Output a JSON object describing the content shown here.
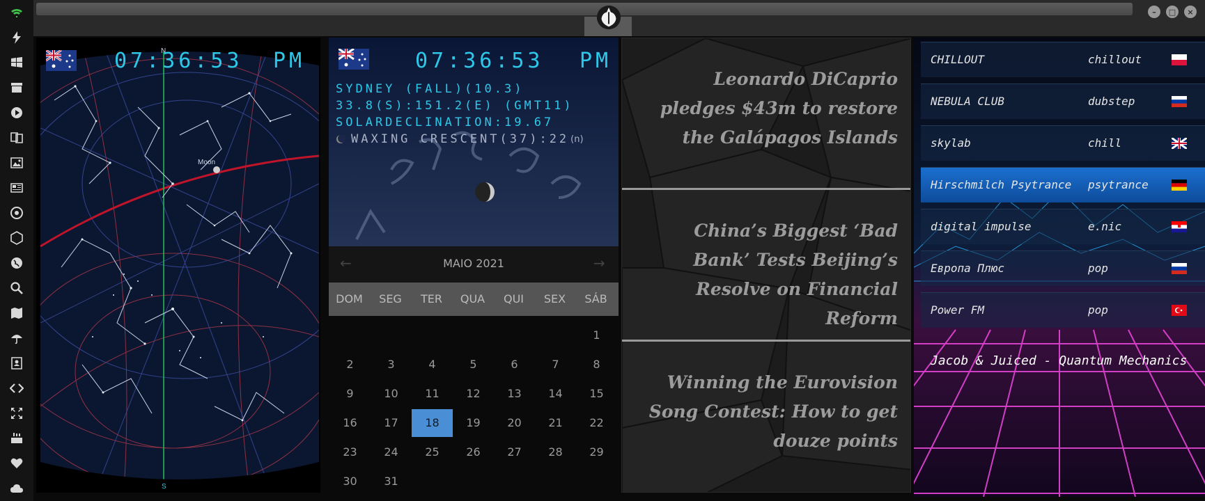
{
  "sidebar": {
    "icons": [
      "wifi-icon",
      "lightning-icon",
      "windows-icon",
      "archive-icon",
      "play-icon",
      "translate-icon",
      "image-icon",
      "newspaper-icon",
      "empire-icon",
      "hexagon-icon",
      "globe-icon",
      "search-icon",
      "map-icon",
      "umbrella-icon",
      "contact-icon",
      "code-icon",
      "expand-icon",
      "youtube-icon",
      "heart-icon",
      "cloud-icon"
    ]
  },
  "colors": {
    "accent": "#2fc7e8",
    "selected_day": "#4a8fd6",
    "active_station": "#1a6fd0"
  },
  "starmap": {
    "clock_time": "07:36:53",
    "clock_ampm": "PM",
    "north_label": "N",
    "south_label": "S",
    "moon_label": "Moon"
  },
  "info": {
    "clock_time": "07:36:53",
    "clock_ampm": "PM",
    "line1": "SYDNEY (FALL)(10.3)",
    "line2": "33.8(S):151.2(E) (GMT11)",
    "line3": "SOLARDECLINATION:19.67",
    "line4": "WAXING CRESCENT(37):22",
    "line4_suffix": "(n)"
  },
  "calendar": {
    "prev": "←",
    "next": "→",
    "month_label": "MAIO 2021",
    "weekdays": [
      "DOM",
      "SEG",
      "TER",
      "QUA",
      "QUI",
      "SEX",
      "SÁB"
    ],
    "first_weekday": 6,
    "days_in_month": 31,
    "selected_day": 18
  },
  "news": {
    "headlines": [
      "Leonardo DiCaprio pledges $43m to restore the Galápagos Islands",
      "China’s Biggest ‘Bad Bank’ Tests Beijing’s Resolve on Financial Reform",
      "Winning the Eurovision Song Contest: How to get douze points"
    ]
  },
  "radio": {
    "stations": [
      {
        "name": "CHILLOUT",
        "genre": "chillout",
        "flag": "pl"
      },
      {
        "name": "NEBULA CLUB",
        "genre": "dubstep",
        "flag": "ru"
      },
      {
        "name": "skylab",
        "genre": "chill",
        "flag": "uk"
      },
      {
        "name": "Hirschmilch Psytrance",
        "genre": "psytrance",
        "flag": "de"
      },
      {
        "name": "digital impulse",
        "genre": "e.nic",
        "flag": "hr"
      },
      {
        "name": "Европа Плюс",
        "genre": "pop",
        "flag": "ru"
      },
      {
        "name": "Power FM",
        "genre": "pop",
        "flag": "tr"
      }
    ],
    "active_index": 3,
    "now_playing": "Jacob & Juiced - Quantum Mechanics"
  }
}
